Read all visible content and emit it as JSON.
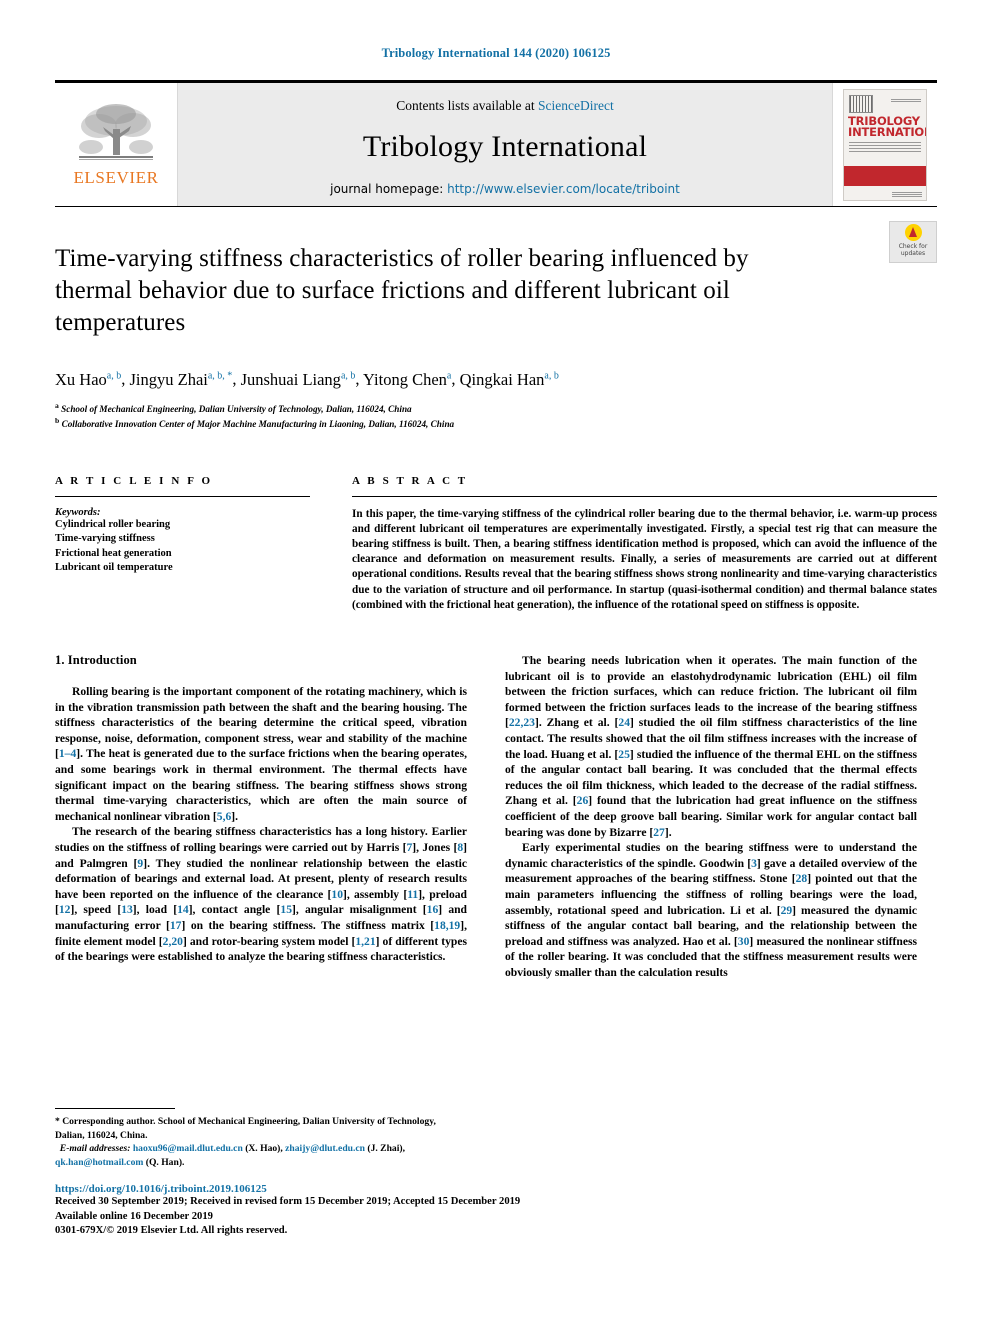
{
  "running_head": "Tribology International 144 (2020) 106125",
  "masthead": {
    "publisher_wordmark": "ELSEVIER",
    "contents_prefix": "Contents lists available at",
    "contents_link": "ScienceDirect",
    "journal_title": "Tribology International",
    "homepage_prefix": "journal homepage:",
    "homepage_url": "http://www.elsevier.com/locate/triboint",
    "cover_title_line1": "TRIBOLOGY",
    "cover_title_line2": "INTERNATIONAL"
  },
  "crossmark": {
    "line1": "Check for",
    "line2": "updates"
  },
  "article": {
    "title": "Time-varying stiffness characteristics of roller bearing influenced by thermal behavior due to surface frictions and different lubricant oil temperatures",
    "authors": [
      {
        "name": "Xu Hao",
        "sup": "a, b",
        "sep": ", "
      },
      {
        "name": "Jingyu Zhai",
        "sup": "a, b, *",
        "sep": ", "
      },
      {
        "name": "Junshuai Liang",
        "sup": "a, b",
        "sep": ", "
      },
      {
        "name": "Yitong Chen",
        "sup": "a",
        "sep": ", "
      },
      {
        "name": "Qingkai Han",
        "sup": "a, b",
        "sep": ""
      }
    ],
    "affiliations": [
      {
        "mark": "a",
        "text": "School of Mechanical Engineering, Dalian University of Technology, Dalian, 116024, China"
      },
      {
        "mark": "b",
        "text": "Collaborative Innovation Center of Major Machine Manufacturing in Liaoning, Dalian, 116024, China"
      }
    ]
  },
  "info": {
    "heading": "A R T I C L E  I N F O",
    "keywords_label": "Keywords:",
    "keywords": [
      "Cylindrical roller bearing",
      "Time-varying stiffness",
      "Frictional heat generation",
      "Lubricant oil temperature"
    ]
  },
  "abstract": {
    "heading": "A B S T R A C T",
    "text": "In this paper, the time-varying stiffness of the cylindrical roller bearing due to the thermal behavior, i.e. warm-up process and different lubricant oil temperatures are experimentally investigated. Firstly, a special test rig that can measure the bearing stiffness is built. Then, a bearing stiffness identification method is proposed, which can avoid the influence of the clearance and deformation on measurement results. Finally, a series of measurements are carried out at different operational conditions. Results reveal that the bearing stiffness shows strong nonlinearity and time-varying characteristics due to the variation of structure and oil performance. In startup (quasi-isothermal condition) and thermal balance states (combined with the frictional heat generation), the influence of the rotational speed on stiffness is opposite."
  },
  "body": {
    "section_number_title": "1.  Introduction",
    "left_paragraphs": [
      "Rolling bearing is the important component of the rotating machinery, which is in the vibration transmission path between the shaft and the bearing housing. The stiffness characteristics of the bearing determine the critical speed, vibration response, noise, deformation, component stress, wear and stability of the machine [1–4]. The heat is generated due to the surface frictions when the bearing operates, and some bearings work in thermal environment. The thermal effects have significant impact on the bearing stiffness. The bearing stiffness shows strong thermal time-varying characteristics, which are often the main source of mechanical nonlinear vibration [5,6].",
      "The research of the bearing stiffness characteristics has a long history. Earlier studies on the stiffness of rolling bearings were carried out by Harris [7], Jones [8] and Palmgren [9]. They studied the nonlinear relationship between the elastic deformation of bearings and external load. At present, plenty of research results have been reported on the influence of the clearance [10], assembly [11], preload [12], speed [13], load [14], contact angle [15], angular misalignment [16] and manufacturing error [17] on the bearing stiffness. The stiffness matrix [18,19], finite element model [2,20] and rotor-bearing system model [1,21] of different types of the bearings were established to analyze the bearing stiffness characteristics."
    ],
    "right_paragraphs": [
      "The bearing needs lubrication when it operates. The main function of the lubricant oil is to provide an elastohydrodynamic lubrication (EHL) oil film between the friction surfaces, which can reduce friction. The lubricant oil film formed between the friction surfaces leads to the increase of the bearing stiffness [22,23]. Zhang et al. [24] studied the oil film stiffness characteristics of the line contact. The results showed that the oil film stiffness increases with the increase of the load. Huang et al. [25] studied the influence of the thermal EHL on the stiffness of the angular contact ball bearing. It was concluded that the thermal effects reduces the oil film thickness, which leaded to the decrease of the radial stiffness. Zhang et al. [26] found that the lubrication had great influence on the stiffness coefficient of the deep groove ball bearing. Similar work for angular contact ball bearing was done by Bizarre [27].",
      "Early experimental studies on the bearing stiffness were to understand the dynamic characteristics of the spindle. Goodwin [3] gave a detailed overview of the measurement approaches of the bearing stiffness. Stone [28] pointed out that the main parameters influencing the stiffness of rolling bearings were the load, assembly, rotational speed and lubrication. Li et al. [29] measured the dynamic stiffness of the angular contact ball bearing, and the relationship between the preload and stiffness was analyzed. Hao et al. [30] measured the nonlinear stiffness of the roller bearing. It was concluded that the stiffness measurement results were obviously smaller than the calculation results"
    ]
  },
  "footnotes": {
    "corresponding": "* Corresponding author. School of Mechanical Engineering, Dalian University of Technology, Dalian, 116024, China.",
    "email_label": "E-mail addresses:",
    "emails": [
      {
        "address": "haoxu96@mail.dlut.edu.cn",
        "who": "(X. Hao)"
      },
      {
        "address": "zhaijy@dlut.edu.cn",
        "who": "(J. Zhai)"
      },
      {
        "address": "qk.han@hotmail.com",
        "who": "(Q. Han)"
      }
    ]
  },
  "footer": {
    "doi": "https://doi.org/10.1016/j.triboint.2019.106125",
    "history": "Received 30 September 2019; Received in revised form 15 December 2019; Accepted 15 December 2019",
    "available": "Available online 16 December 2019",
    "copyright": "0301-679X/© 2019 Elsevier Ltd. All rights reserved."
  },
  "colors": {
    "link_blue": "#1371a5",
    "elsevier_orange": "#e87722",
    "cover_red": "#c1272d"
  }
}
